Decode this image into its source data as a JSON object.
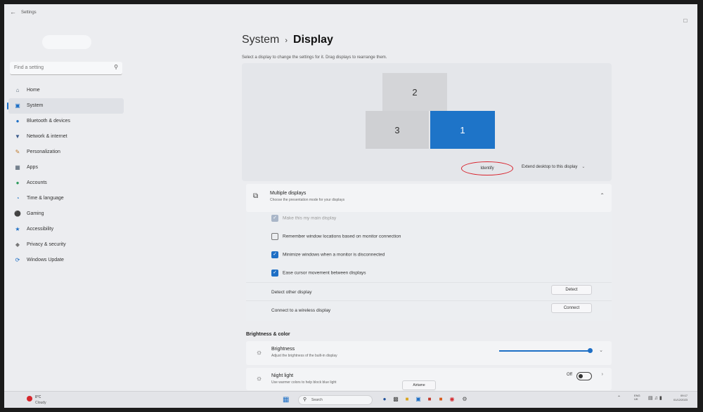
{
  "app": {
    "title": "Settings"
  },
  "sidebar": {
    "search_placeholder": "Find a setting",
    "items": [
      {
        "label": "Home",
        "icon": "home-icon"
      },
      {
        "label": "System",
        "icon": "monitor-icon",
        "active": true
      },
      {
        "label": "Bluetooth & devices",
        "icon": "bluetooth-icon"
      },
      {
        "label": "Network & internet",
        "icon": "wifi-icon"
      },
      {
        "label": "Personalization",
        "icon": "pencil-icon"
      },
      {
        "label": "Apps",
        "icon": "apps-icon"
      },
      {
        "label": "Accounts",
        "icon": "person-icon"
      },
      {
        "label": "Time & language",
        "icon": "globe-icon"
      },
      {
        "label": "Gaming",
        "icon": "gamepad-icon"
      },
      {
        "label": "Accessibility",
        "icon": "accessibility-icon"
      },
      {
        "label": "Privacy & security",
        "icon": "shield-icon"
      },
      {
        "label": "Windows Update",
        "icon": "update-icon"
      }
    ]
  },
  "header": {
    "crumb_parent": "System",
    "crumb_current": "Display",
    "subtitle": "Select a display to change the settings for it. Drag displays to rearrange them."
  },
  "arrangement": {
    "monitors": [
      {
        "label": "2",
        "selected": false
      },
      {
        "label": "3",
        "selected": false
      },
      {
        "label": "1",
        "selected": true
      }
    ],
    "identify_label": "Identify",
    "extend_label": "Extend desktop to this display",
    "highlight_color": "#d8202a"
  },
  "multiple_displays": {
    "title": "Multiple displays",
    "subtitle": "Choose the presentation mode for your displays",
    "options": [
      {
        "label": "Make this my main display",
        "checked": true,
        "disabled": true
      },
      {
        "label": "Remember window locations based on monitor connection",
        "checked": false
      },
      {
        "label": "Minimize windows when a monitor is disconnected",
        "checked": true
      },
      {
        "label": "Ease cursor movement between displays",
        "checked": true
      }
    ],
    "detect_label": "Detect other display",
    "detect_button": "Detect",
    "wireless_label": "Connect to a wireless display",
    "connect_button": "Connect"
  },
  "brightness_color": {
    "section_title": "Brightness & color",
    "brightness": {
      "title": "Brightness",
      "subtitle": "Adjust the brightness of the built-in display",
      "value_pct": 100
    },
    "night_light": {
      "title": "Night light",
      "subtitle": "Use warmer colors to help block blue light",
      "state_label": "Off",
      "on": false
    }
  },
  "taskbar": {
    "temperature": "8°C",
    "condition": "Cloudy",
    "search_label": "Search",
    "tooltip": "Airtame",
    "lang_line1": "ENG",
    "lang_line2": "UK",
    "time": "09:17",
    "date": "01/12/2023"
  },
  "colors": {
    "accent": "#1e6fc5",
    "selected_monitor": "#1e74c8"
  }
}
